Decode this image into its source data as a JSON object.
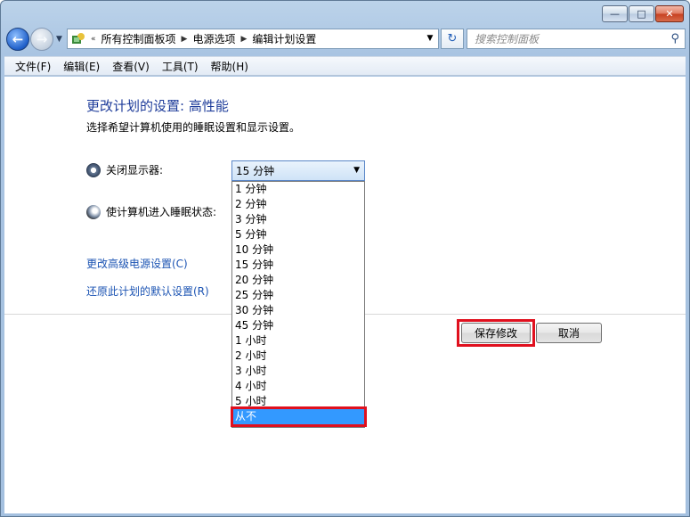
{
  "address": {
    "crumbs": [
      "所有控制面板项",
      "电源选项",
      "编辑计划设置"
    ],
    "overflow": "«"
  },
  "search": {
    "placeholder": "搜索控制面板"
  },
  "menu": [
    "文件(F)",
    "编辑(E)",
    "查看(V)",
    "工具(T)",
    "帮助(H)"
  ],
  "page": {
    "title": "更改计划的设置: 高性能",
    "subtitle": "选择希望计算机使用的睡眠设置和显示设置。"
  },
  "settings": {
    "display_label": "关闭显示器:",
    "sleep_label": "使计算机进入睡眠状态:",
    "display_value": "15 分钟"
  },
  "dropdown_options": [
    "1 分钟",
    "2 分钟",
    "3 分钟",
    "5 分钟",
    "10 分钟",
    "15 分钟",
    "20 分钟",
    "25 分钟",
    "30 分钟",
    "45 分钟",
    "1 小时",
    "2 小时",
    "3 小时",
    "4 小时",
    "5 小时",
    "从不"
  ],
  "selected_option": "从不",
  "links": {
    "advanced": "更改高级电源设置(C)",
    "restore": "还原此计划的默认设置(R)"
  },
  "buttons": {
    "save": "保存修改",
    "cancel": "取消"
  }
}
